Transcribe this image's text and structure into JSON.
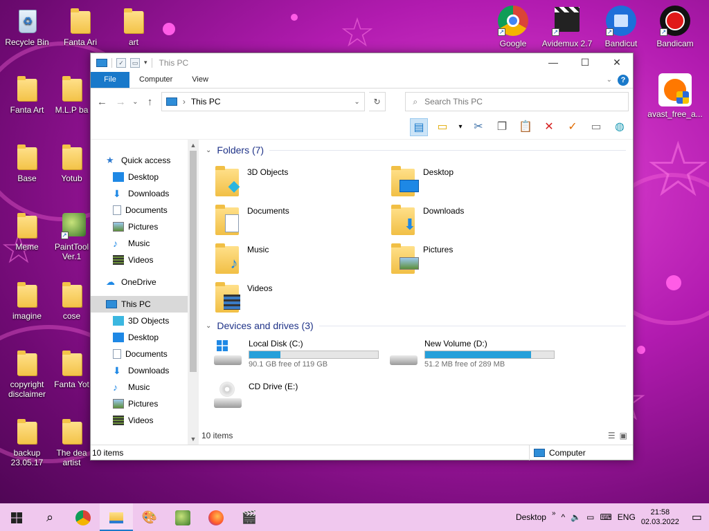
{
  "desktop": {
    "icons": [
      {
        "label": "Recycle Bin"
      },
      {
        "label": "Fanta Ari"
      },
      {
        "label": "art"
      },
      {
        "label": "Fanta Art"
      },
      {
        "label": "M.L.P ba"
      },
      {
        "label": "Base"
      },
      {
        "label": "Yotub"
      },
      {
        "label": "Meme"
      },
      {
        "label": "PaintTool Ver.1"
      },
      {
        "label": "imagine"
      },
      {
        "label": "cose"
      },
      {
        "label": "copyright disclaimer"
      },
      {
        "label": "Fanta Yot"
      },
      {
        "label": "backup 23.05.17"
      },
      {
        "label": "The dea artist"
      },
      {
        "label": "Google"
      },
      {
        "label": "Avidemux 2.7"
      },
      {
        "label": "Bandicut"
      },
      {
        "label": "Bandicam"
      },
      {
        "label": "avast_free_a..."
      }
    ]
  },
  "window": {
    "title": "This PC",
    "ribbon_tabs": {
      "file": "File",
      "computer": "Computer",
      "view": "View"
    },
    "address": "This PC",
    "search_placeholder": "Search This PC",
    "nav": {
      "quick_access": "Quick access",
      "qa_items": [
        "Desktop",
        "Downloads",
        "Documents",
        "Pictures",
        "Music",
        "Videos"
      ],
      "onedrive": "OneDrive",
      "this_pc": "This PC",
      "pc_items": [
        "3D Objects",
        "Desktop",
        "Documents",
        "Downloads",
        "Music",
        "Pictures",
        "Videos"
      ]
    },
    "folders_header": "Folders (7)",
    "folders": [
      {
        "name": "3D Objects"
      },
      {
        "name": "Desktop"
      },
      {
        "name": "Documents"
      },
      {
        "name": "Downloads"
      },
      {
        "name": "Music"
      },
      {
        "name": "Pictures"
      },
      {
        "name": "Videos"
      }
    ],
    "drives_header": "Devices and drives (3)",
    "drives": [
      {
        "name": "Local Disk (C:)",
        "free": "90.1 GB free of 119 GB",
        "used_fraction": 0.24
      },
      {
        "name": "New Volume (D:)",
        "free": "51.2 MB free of 289 MB",
        "used_fraction": 0.82
      },
      {
        "name": "CD Drive (E:)",
        "free": "",
        "used_fraction": null
      }
    ],
    "item_count": "10 items",
    "status_left": "10 items",
    "status_right": "Computer"
  },
  "taskbar": {
    "desktop_label": "Desktop",
    "language": "ENG",
    "time": "21:58",
    "date": "02.03.2022"
  },
  "colors": {
    "accent": "#1979ca",
    "drive_bar": "#26a0da",
    "taskbar": "#f0c8ee"
  }
}
